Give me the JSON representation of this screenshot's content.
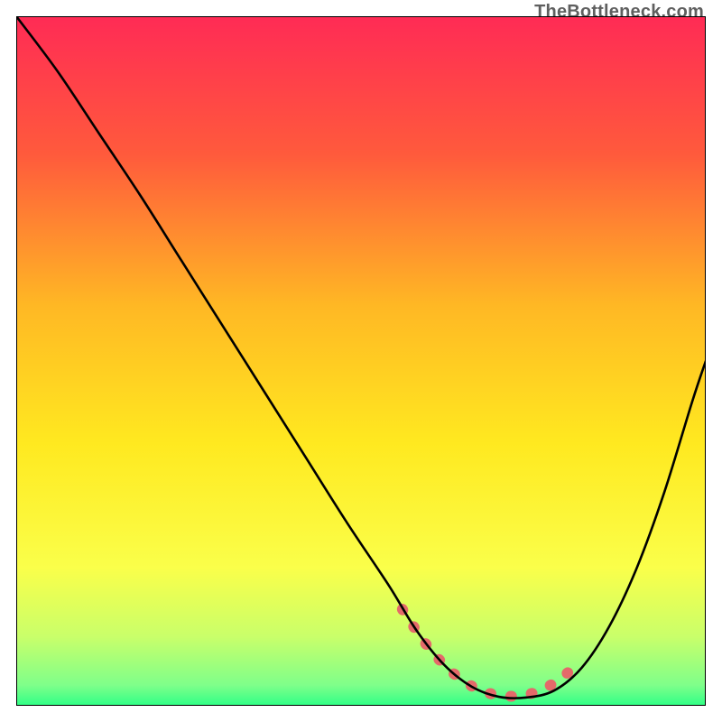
{
  "watermark": "TheBottleneck.com",
  "chart_data": {
    "type": "line",
    "title": "",
    "xlabel": "",
    "ylabel": "",
    "xlim": [
      0,
      100
    ],
    "ylim": [
      0,
      100
    ],
    "grid": false,
    "background_gradient": {
      "stops": [
        {
          "offset": 0.0,
          "color": "#ff2b55"
        },
        {
          "offset": 0.2,
          "color": "#ff5a3c"
        },
        {
          "offset": 0.42,
          "color": "#ffb824"
        },
        {
          "offset": 0.62,
          "color": "#ffe920"
        },
        {
          "offset": 0.8,
          "color": "#faff4a"
        },
        {
          "offset": 0.9,
          "color": "#c9ff6a"
        },
        {
          "offset": 0.97,
          "color": "#7fff8a"
        },
        {
          "offset": 1.0,
          "color": "#2fff86"
        }
      ]
    },
    "series": [
      {
        "name": "curve",
        "color": "#000000",
        "width": 2.6,
        "x": [
          0,
          6,
          12,
          18,
          24,
          30,
          36,
          42,
          48,
          54,
          58,
          62,
          66,
          70,
          74,
          78,
          82,
          86,
          90,
          94,
          98,
          100
        ],
        "y": [
          100,
          92,
          83,
          74,
          64.5,
          55,
          45.5,
          36,
          26.5,
          17.5,
          11,
          6,
          2.8,
          1.3,
          1.2,
          2.2,
          5.5,
          11.5,
          20,
          31,
          44,
          50
        ]
      }
    ],
    "overlay": {
      "name": "valley-highlight",
      "color": "#e46a6a",
      "width": 12,
      "x": [
        56,
        59,
        62,
        65,
        68,
        71,
        74,
        77,
        80
      ],
      "y": [
        14,
        9.5,
        6,
        3.5,
        2,
        1.4,
        1.6,
        2.7,
        4.8
      ]
    }
  }
}
